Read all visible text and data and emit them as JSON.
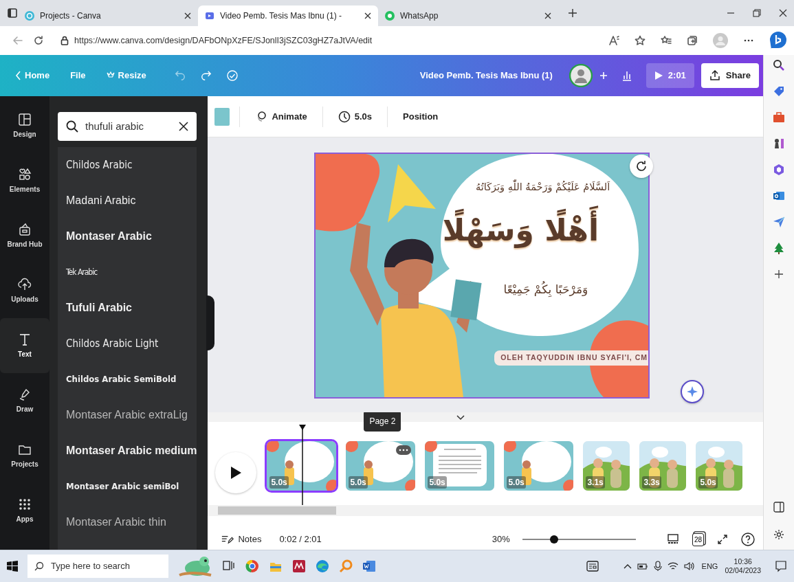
{
  "browser": {
    "tabs": [
      {
        "title": "Projects - Canva",
        "selected": false,
        "kind": "canva"
      },
      {
        "title": "Video Pemb. Tesis Mas Ibnu (1) -",
        "selected": true,
        "kind": "video"
      },
      {
        "title": "WhatsApp",
        "selected": false,
        "kind": "whatsapp"
      }
    ],
    "url": "https://www.canva.com/design/DAFbONpXzFE/SJonlI3jSZC03gHZ7aJtVA/edit"
  },
  "menu": [
    {
      "label": "Home",
      "kind": "back"
    },
    {
      "label": "File",
      "kind": "plain"
    },
    {
      "label": "Resize",
      "kind": "crown"
    }
  ],
  "design_title": "Video Pemb. Tesis Mas Ibnu (1)",
  "play_time": "2:01",
  "share": "Share",
  "rail": [
    {
      "label": "Design",
      "selected": false,
      "kind": "design"
    },
    {
      "label": "Elements",
      "selected": false,
      "kind": "elements"
    },
    {
      "label": "Brand Hub",
      "selected": false,
      "kind": "brand"
    },
    {
      "label": "Uploads",
      "selected": false,
      "kind": "uploads"
    },
    {
      "label": "Text",
      "selected": true,
      "kind": "text"
    },
    {
      "label": "Draw",
      "selected": false,
      "kind": "draw"
    },
    {
      "label": "Projects",
      "selected": false,
      "kind": "projects"
    },
    {
      "label": "Apps",
      "selected": false,
      "kind": "apps"
    }
  ],
  "search": {
    "value": "thufuli arabic"
  },
  "fonts": [
    {
      "name": "Childos Arabic",
      "kind": "rounded"
    },
    {
      "name": "Madani Arabic",
      "kind": "regular"
    },
    {
      "name": "Montaser Arabic",
      "kind": "medium"
    },
    {
      "name": "Tek Arabic",
      "kind": "narrow"
    },
    {
      "name": "Tufuli Arabic",
      "kind": "medium"
    },
    {
      "name": "Childos Arabic Light",
      "kind": "rounded"
    },
    {
      "name": "Childos Arabic SemiBold",
      "kind": "bold"
    },
    {
      "name": "Montaser Arabic extraLig",
      "kind": "light"
    },
    {
      "name": "Montaser Arabic medium",
      "kind": "medium"
    },
    {
      "name": "Montaser Arabic semiBol",
      "kind": "bold"
    },
    {
      "name": "Montaser Arabic thin",
      "kind": "light"
    }
  ],
  "toolbar": {
    "animate": "Animate",
    "duration": "5.0s",
    "position": "Position"
  },
  "slide": {
    "greeting": "اَلسَّلَامُ عَلَيْكُمْ وَرَحْمَةُ اللّٰهِ وَبَرَكَاتُهُ",
    "title": "أَهْلًا وَسَهْلًا",
    "welcome": "وَمَرْحَبًا بِكُمْ جَمِيْعًا",
    "author": "OLEH TAQYUDDIN IBNU SYAFI'I, CM"
  },
  "timeline": {
    "tooltip": "Page 2",
    "pages": [
      {
        "duration": "5.0s",
        "selected": true,
        "kind": "bubble"
      },
      {
        "duration": "5.0s",
        "selected": false,
        "kind": "bubble"
      },
      {
        "duration": "5.0s",
        "selected": false,
        "kind": "text"
      },
      {
        "duration": "5.0s",
        "selected": false,
        "kind": "bubble"
      },
      {
        "duration": "3.1s",
        "selected": false,
        "kind": "scene"
      },
      {
        "duration": "3.3s",
        "selected": false,
        "kind": "scene"
      },
      {
        "duration": "5.0s",
        "selected": false,
        "kind": "scene"
      }
    ]
  },
  "footer": {
    "notes": "Notes",
    "time": "0:02 / 2:01",
    "zoom": "30%",
    "zoom_slider": {
      "level": 0.28
    },
    "page_count": "28"
  },
  "taskbar": {
    "search_placeholder": "Type here to search",
    "language": "ENG",
    "time": "10:36",
    "date": "02/04/2023"
  }
}
